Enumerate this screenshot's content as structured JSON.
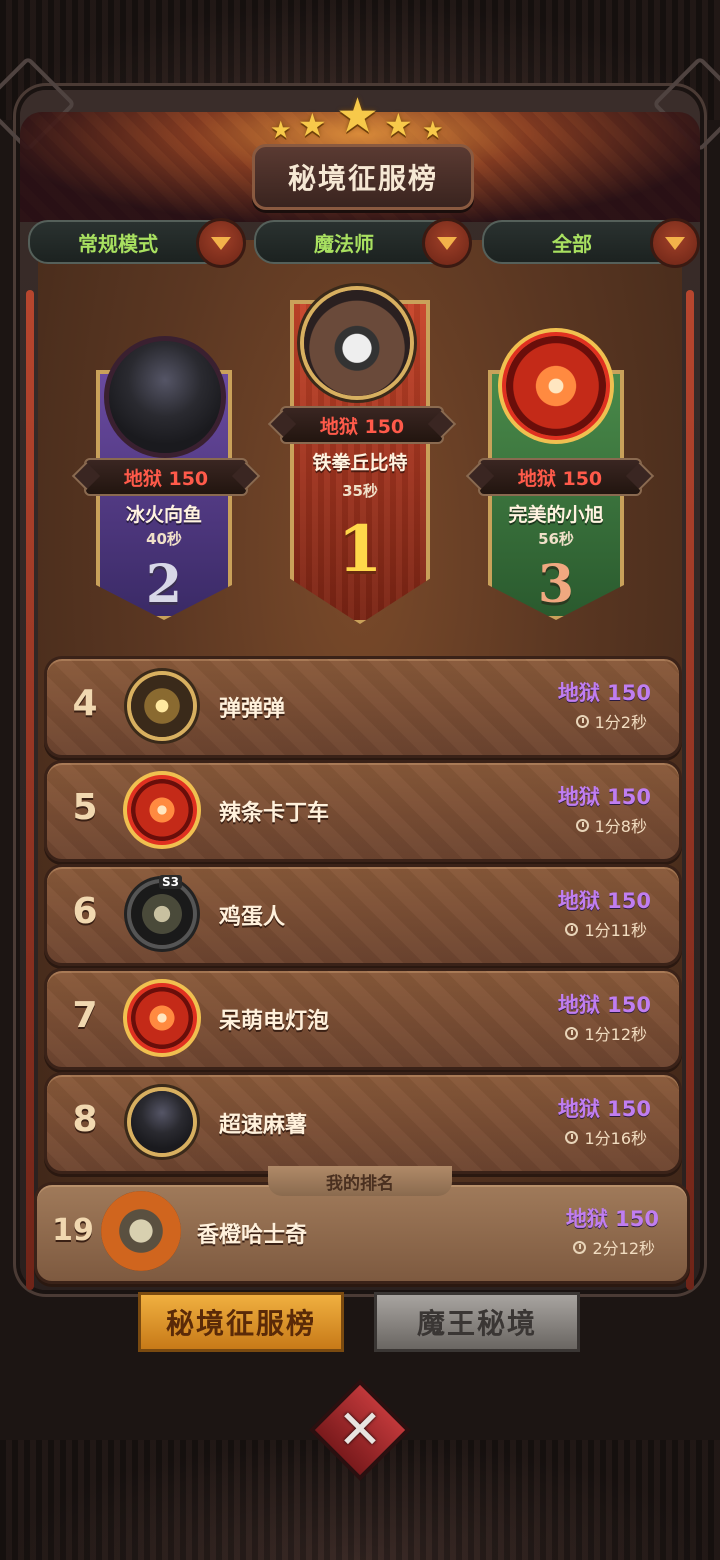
{
  "title": "秘境征服榜",
  "filters": [
    {
      "label": "常规模式"
    },
    {
      "label": "魔法师"
    },
    {
      "label": "全部"
    }
  ],
  "podium": [
    {
      "rank": "2",
      "difficulty": "地狱 150",
      "name": "冰火向鱼",
      "time": "40秒",
      "avatar_icon": "witch-hat-avatar-icon"
    },
    {
      "rank": "1",
      "difficulty": "地狱 150",
      "name": "铁拳丘比特",
      "time": "35秒",
      "avatar_icon": "sheep-avatar-icon"
    },
    {
      "rank": "3",
      "difficulty": "地狱 150",
      "name": "完美的小旭",
      "time": "56秒",
      "avatar_icon": "fire-swirl-avatar-icon"
    }
  ],
  "list": [
    {
      "rank": "4",
      "name": "弹弹弹",
      "difficulty": "地狱 150",
      "time": "1分2秒",
      "avatar_icon": "lantern-avatar-icon"
    },
    {
      "rank": "5",
      "name": "辣条卡丁车",
      "difficulty": "地狱 150",
      "time": "1分8秒",
      "avatar_icon": "fire-swirl-avatar-icon"
    },
    {
      "rank": "6",
      "name": "鸡蛋人",
      "difficulty": "地狱 150",
      "time": "1分11秒",
      "avatar_icon": "goblin-avatar-icon",
      "badge": "S3"
    },
    {
      "rank": "7",
      "name": "呆萌电灯泡",
      "difficulty": "地狱 150",
      "time": "1分12秒",
      "avatar_icon": "fire-swirl-avatar-icon"
    },
    {
      "rank": "8",
      "name": "超速麻薯",
      "difficulty": "地狱 150",
      "time": "1分16秒",
      "avatar_icon": "witch-hat-avatar-icon"
    }
  ],
  "my_rank": {
    "label": "我的排名",
    "rank": "19",
    "name": "香橙哈士奇",
    "difficulty": "地狱 150",
    "time": "2分12秒",
    "avatar_icon": "pumpkin-avatar-icon"
  },
  "tabs": [
    {
      "label": "秘境征服榜",
      "active": true
    },
    {
      "label": "魔王秘境",
      "active": false
    }
  ],
  "colors": {
    "difficulty_purple": "#c07ef0",
    "difficulty_red": "#ff5a4a",
    "filter_green": "#a8e060",
    "active_tab": "#f0b040"
  }
}
